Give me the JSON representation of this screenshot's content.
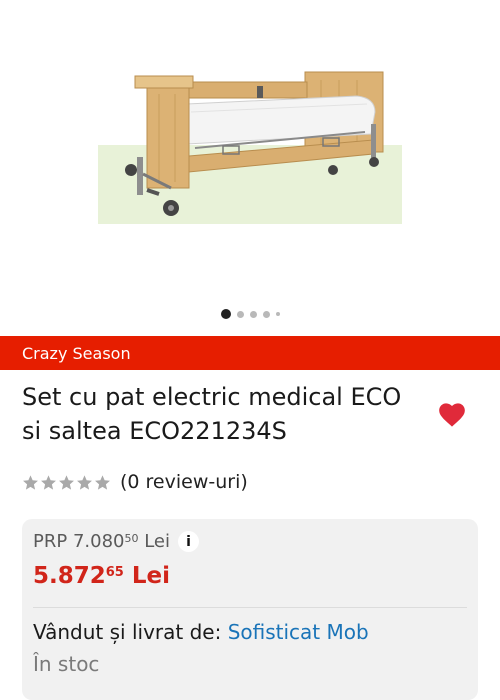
{
  "gallery": {
    "image_alt": "medical bed with mattress",
    "dot_count": 5,
    "active_index": 0
  },
  "promo": {
    "label": "Crazy Season",
    "color": "#e61e00"
  },
  "product": {
    "title": "Set cu pat electric medical ECO si saltea ECO221234S",
    "favorite": true
  },
  "rating": {
    "stars": 0,
    "max_stars": 5,
    "review_text": "(0 review-uri)"
  },
  "pricing": {
    "prp_label": "PRP",
    "prp_integer": "7.080",
    "prp_decimal": "50",
    "prp_currency": "Lei",
    "info_icon": "i",
    "price_integer": "5.872",
    "price_decimal": "65",
    "price_currency": "Lei",
    "price_color": "#d1251a"
  },
  "seller": {
    "label": "Vândut și livrat de:",
    "name": "Sofisticat Mob",
    "stock": "În stoc"
  }
}
